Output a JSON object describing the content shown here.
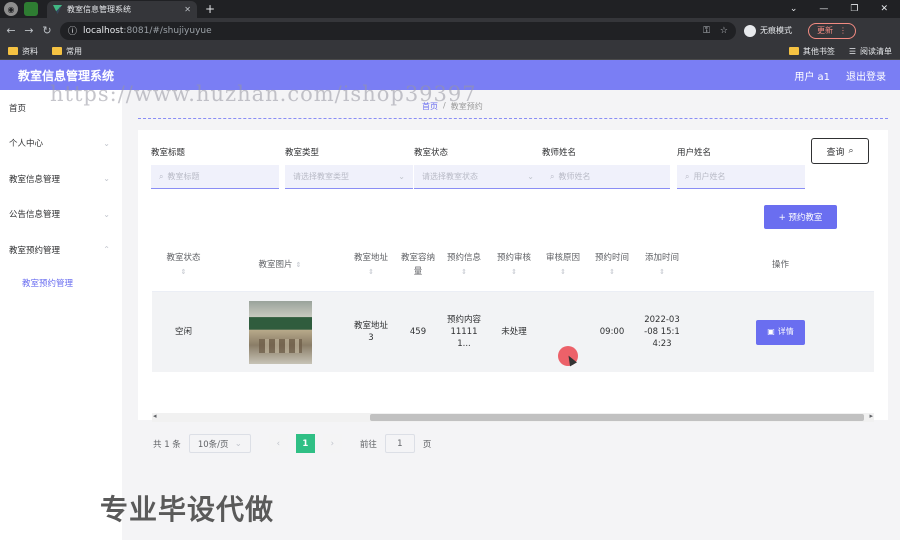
{
  "browser": {
    "tab_title": "教室信息管理系统",
    "url_host": "localhost",
    "url_path": ":8081/#/shujiyuyue",
    "incognito_label": "无痕模式",
    "update_label": "更新",
    "bookmarks": [
      "资料",
      "常用"
    ],
    "bookmarks_right": [
      "其他书签",
      "阅读清单"
    ]
  },
  "header": {
    "title": "教室信息管理系统",
    "user_label": "用户 a1",
    "logout_label": "退出登录"
  },
  "sidebar": {
    "items": [
      {
        "label": "首页"
      },
      {
        "label": "个人中心"
      },
      {
        "label": "教室信息管理"
      },
      {
        "label": "公告信息管理"
      },
      {
        "label": "教室预约管理"
      }
    ],
    "submenu": [
      {
        "label": "教室预约管理"
      }
    ]
  },
  "breadcrumb": {
    "home": "首页",
    "current": "教室预约"
  },
  "filters": [
    {
      "label": "教室标题",
      "placeholder": "教室标题"
    },
    {
      "label": "教室类型",
      "placeholder": "请选择教室类型"
    },
    {
      "label": "教室状态",
      "placeholder": "请选择教室状态"
    },
    {
      "label": "教师姓名",
      "placeholder": "教师姓名"
    },
    {
      "label": "用户姓名",
      "placeholder": "用户姓名"
    }
  ],
  "search_button": "查询",
  "add_button": "+ 预约教室",
  "table": {
    "columns": [
      "教室状态",
      "教室图片",
      "教室地址",
      "教室容纳量",
      "预约信息",
      "预约审核",
      "审核原因",
      "预约时间",
      "添加时间",
      "操作"
    ],
    "rows": [
      {
        "status": "空闲",
        "address": "教室地址3",
        "capacity": "459",
        "booking_info": "预约内容11111 1...",
        "review": "未处理",
        "reason": "",
        "time": "09:00",
        "added": "2022-03-08 15:14:23",
        "action": "详情"
      }
    ]
  },
  "pagination": {
    "total": "共 1 条",
    "page_size": "10条/页",
    "current_page": "1",
    "goto_label": "前往",
    "goto_value": "1",
    "page_suffix": "页"
  },
  "watermark": "https://www.huzhan.com/ishop39397",
  "overlay_caption": "专业毕设代做"
}
